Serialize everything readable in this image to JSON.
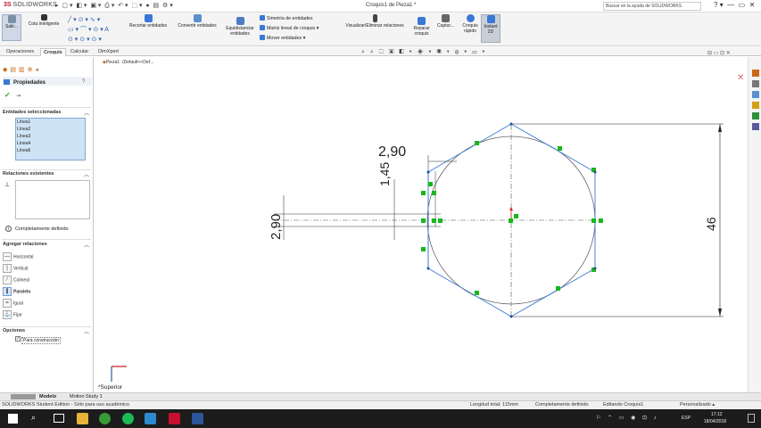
{
  "app": {
    "logo": "SOLIDWORKS",
    "doc_title": "Croquis1 de Pieza1 *",
    "help_search_placeholder": "Buscar en la ayuda de SOLIDWORKS"
  },
  "ribbon": {
    "exit_sketch": "Salir...",
    "smart_dimension": "Cota inteligente",
    "trim": "Recortar entidades",
    "convert": "Convertir entidades",
    "offset": "Equidistanciar entidades",
    "mirror": "Simetría de entidades",
    "linear_pattern": "Matriz lineal de croquis",
    "move": "Mover entidades",
    "display_relations": "Visualizar/Eliminar relaciones",
    "repair": "Reparar croquis",
    "capture": "Captur...",
    "quick_snaps": "Croquis rápido",
    "instant2d": "Instant 2D"
  },
  "tabs": [
    "Operaciones",
    "Croquis",
    "Calcular",
    "DimXpert"
  ],
  "active_tab": "Croquis",
  "tree": {
    "part": "Pieza1",
    "config": "(Default<<Def..."
  },
  "properties": {
    "title": "Propiedades",
    "selected_header": "Entidades seleccionadas",
    "selected": [
      "Línea1",
      "Línea2",
      "Línea3",
      "Línea4",
      "Línea6"
    ],
    "existing_header": "Relaciones existentes",
    "status": "Completamente definido",
    "add_header": "Agregar relaciones",
    "relations": [
      "Horizontal",
      "Vertical",
      "Colineal",
      "Paralelo",
      "Igual",
      "Fijar"
    ],
    "options_header": "Opciones",
    "construction": "Para construcción"
  },
  "dimensions": {
    "d1": "2,90",
    "d2": "1,45",
    "d3": "2,90",
    "d4": "46"
  },
  "view_label": "*Superior",
  "bottom_tabs": [
    "Modelo",
    "Motion Study 1"
  ],
  "status": {
    "edition": "SOLIDWORKS Student Edition - Sólo para uso académico",
    "length": "Longitud total: 115mm",
    "defined": "Completamente definido",
    "editing": "Editando Croquis1",
    "units": "Personalizado"
  },
  "taskbar": {
    "lang": "ESP",
    "time": "17:12",
    "date": "18/04/2018"
  },
  "colors": {
    "sketch_blue": "#3a78d6",
    "relation_green": "#18b818",
    "brand_red": "#c8102e",
    "dimension": "#222222"
  }
}
